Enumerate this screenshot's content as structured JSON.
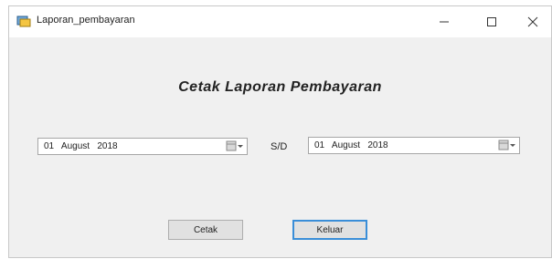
{
  "window": {
    "title": "Laporan_pembayaran",
    "controls": {
      "minimize": "minimize-icon",
      "maximize": "maximize-icon",
      "close": "close-icon"
    }
  },
  "form": {
    "heading": "Cetak Laporan Pembayaran",
    "date_from": {
      "value": "01   August   2018"
    },
    "separator_label": "S/D",
    "date_to": {
      "value": "01   August   2018"
    },
    "buttons": {
      "print": "Cetak",
      "exit": "Keluar"
    }
  },
  "colors": {
    "focus_border": "#3a8ed8",
    "window_bg": "#f0f0f0"
  }
}
